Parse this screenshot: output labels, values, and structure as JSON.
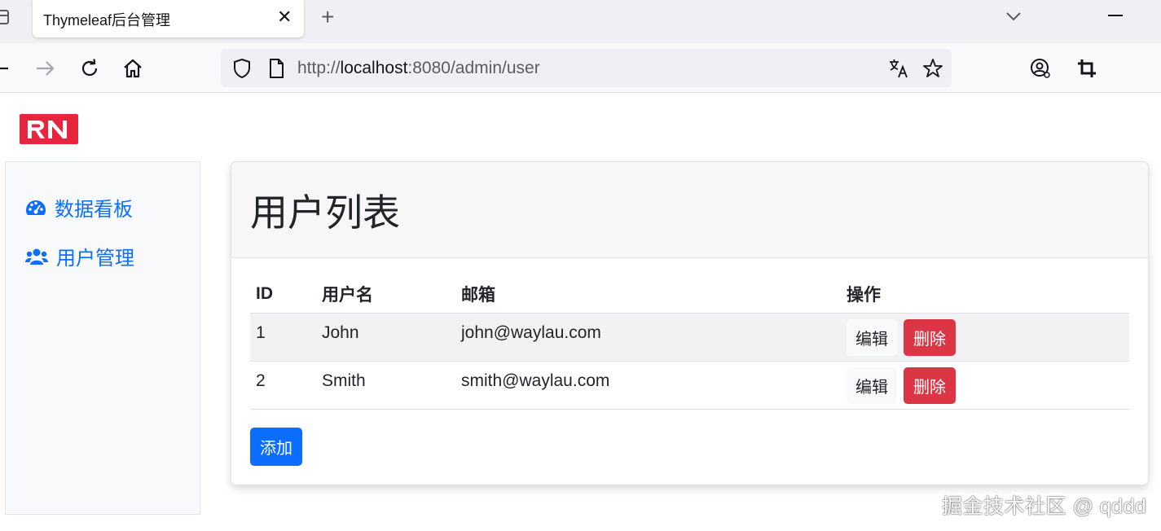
{
  "browser": {
    "tab_title": "Thymeleaf后台管理",
    "tab_close": "✕",
    "new_tab": "+",
    "url_prefix": "http://",
    "url_host": "localhost",
    "url_rest": ":8080/admin/user"
  },
  "logo": {
    "text": "RN",
    "color": "#e8253f"
  },
  "sidebar": {
    "items": [
      {
        "label": "数据看板",
        "icon": "tachometer-icon"
      },
      {
        "label": "用户管理",
        "icon": "users-icon"
      }
    ]
  },
  "main": {
    "title": "用户列表",
    "table": {
      "headers": [
        "ID",
        "用户名",
        "邮箱",
        "操作"
      ],
      "rows": [
        {
          "id": "1",
          "username": "John",
          "email": "john@waylau.com",
          "edit": "编辑",
          "delete": "删除"
        },
        {
          "id": "2",
          "username": "Smith",
          "email": "smith@waylau.com",
          "edit": "编辑",
          "delete": "删除"
        }
      ]
    },
    "add_label": "添加"
  },
  "watermark": "掘金技术社区 @ qddd",
  "colors": {
    "primary": "#0d6efd",
    "danger": "#dc3545"
  }
}
